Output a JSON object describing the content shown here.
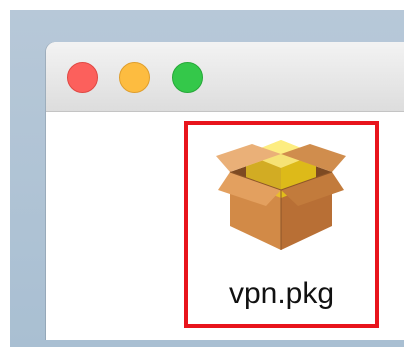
{
  "window": {
    "controls": {
      "close_color": "#fc605c",
      "minimize_color": "#fdbc40",
      "zoom_color": "#34c84a"
    }
  },
  "file": {
    "name": "vpn.pkg",
    "icon": "package-icon",
    "highlight_color": "#e8141c"
  }
}
